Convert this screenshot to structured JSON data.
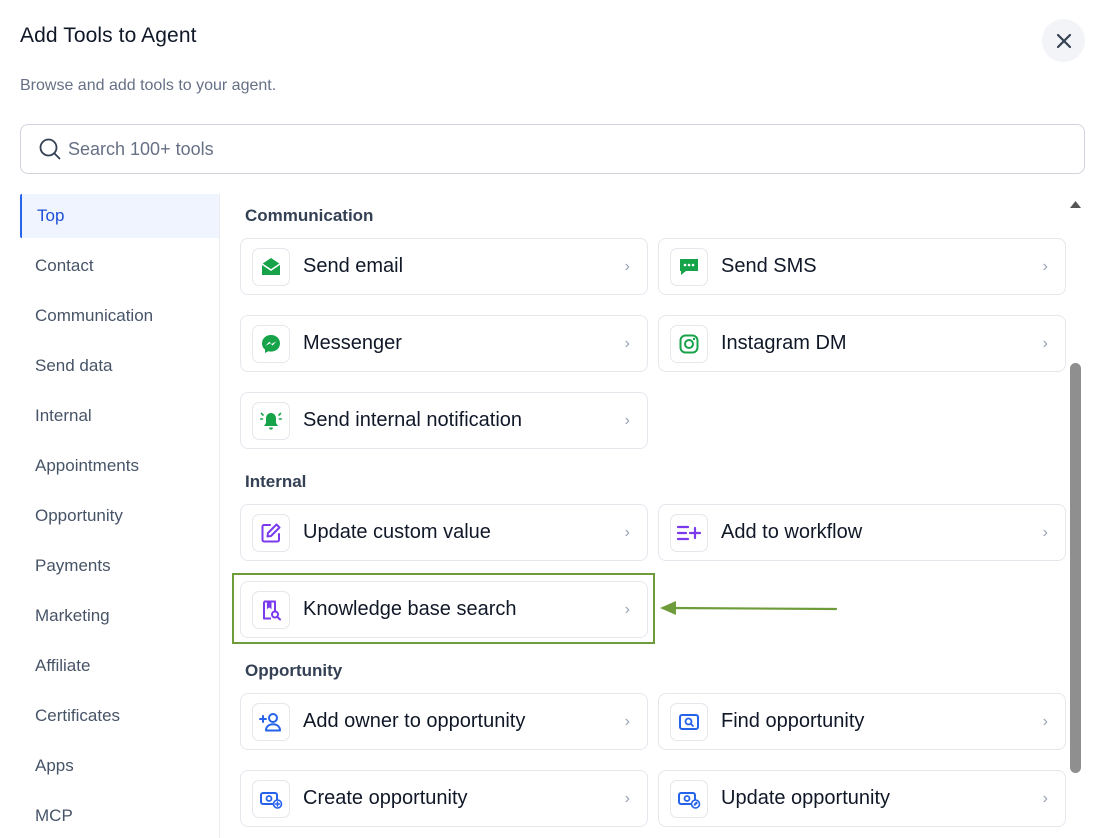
{
  "dialog": {
    "title": "Add Tools to Agent",
    "subtitle": "Browse and add tools to your agent.",
    "close_icon": "close-icon"
  },
  "search": {
    "placeholder": "Search 100+ tools",
    "value": "",
    "icon": "search-icon"
  },
  "sidebar": {
    "active": "Top",
    "items": [
      {
        "label": "Top"
      },
      {
        "label": "Contact"
      },
      {
        "label": "Communication"
      },
      {
        "label": "Send data"
      },
      {
        "label": "Internal"
      },
      {
        "label": "Appointments"
      },
      {
        "label": "Opportunity"
      },
      {
        "label": "Payments"
      },
      {
        "label": "Marketing"
      },
      {
        "label": "Affiliate"
      },
      {
        "label": "Certificates"
      },
      {
        "label": "Apps"
      },
      {
        "label": "MCP"
      }
    ]
  },
  "sections": [
    {
      "title": "Communication",
      "tools": [
        {
          "label": "Send email",
          "icon": "email-icon",
          "color": "#16a34a"
        },
        {
          "label": "Send SMS",
          "icon": "sms-icon",
          "color": "#16a34a"
        },
        {
          "label": "Messenger",
          "icon": "messenger-icon",
          "color": "#16a34a"
        },
        {
          "label": "Instagram DM",
          "icon": "instagram-icon",
          "color": "#16a34a"
        },
        {
          "label": "Send internal notification",
          "icon": "bell-icon",
          "color": "#16a34a"
        }
      ]
    },
    {
      "title": "Internal",
      "tools": [
        {
          "label": "Update custom value",
          "icon": "edit-icon",
          "color": "#7c3aed"
        },
        {
          "label": "Add to workflow",
          "icon": "list-add-icon",
          "color": "#7c3aed"
        },
        {
          "label": "Knowledge base search",
          "icon": "book-search-icon",
          "color": "#7c3aed"
        }
      ]
    },
    {
      "title": "Opportunity",
      "tools": [
        {
          "label": "Add owner to opportunity",
          "icon": "user-add-icon",
          "color": "#2563eb"
        },
        {
          "label": "Find opportunity",
          "icon": "find-icon",
          "color": "#2563eb"
        },
        {
          "label": "Create opportunity",
          "icon": "money-add-icon",
          "color": "#2563eb"
        },
        {
          "label": "Update opportunity",
          "icon": "money-edit-icon",
          "color": "#2563eb"
        }
      ]
    }
  ],
  "annotation": {
    "highlight_color": "#6f9c3b"
  },
  "colors": {
    "accent": "#2563eb",
    "communication": "#16a34a",
    "internal": "#7c3aed",
    "opportunity": "#2563eb"
  }
}
